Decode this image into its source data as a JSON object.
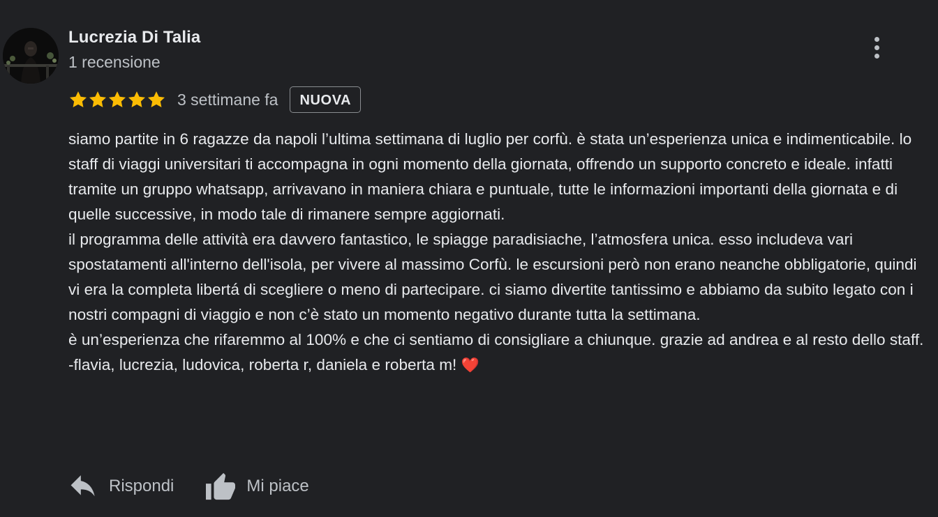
{
  "review": {
    "author": {
      "name": "Lucrezia Di Talia",
      "review_count": "1 recensione",
      "avatar_icon": "profile-photo"
    },
    "rating": 5,
    "time": "3 settimane fa",
    "badge": "NUOVA",
    "star_color": "#fbbc04",
    "body": {
      "p1": "siamo partite in 6 ragazze da napoli l’ultima settimana di luglio per corfù. è stata un’esperienza unica e indimenticabile. lo staff di viaggi universitari ti accompagna in ogni momento della giornata, offrendo un supporto concreto e ideale. infatti tramite un gruppo whatsapp, arrivavano in maniera chiara e puntuale, tutte le informazioni importanti della giornata e di quelle successive, in modo tale di rimanere sempre aggiornati.",
      "p2": "il programma delle attività era davvero fantastico, le spiagge paradisiache, l’atmosfera unica. esso includeva vari spostatamenti all'interno dell'isola, per vivere al massimo Corfù. le escursioni però non erano neanche obbligatorie, quindi vi era la completa libertá di scegliere o meno di partecipare. ci siamo divertite tantissimo e abbiamo da subito legato con i nostri compagni di viaggio e non c’è stato un momento negativo durante tutta la settimana.",
      "p3": "è un’esperienza che rifaremmo al 100% e che ci sentiamo di consigliare a chiunque. grazie ad andrea e al resto dello staff.",
      "p4": "-flavia, lucrezia, ludovica, roberta r, daniela e roberta m!",
      "heart": "❤️"
    },
    "actions": {
      "reply_label": "Rispondi",
      "like_label": "Mi piace"
    }
  }
}
